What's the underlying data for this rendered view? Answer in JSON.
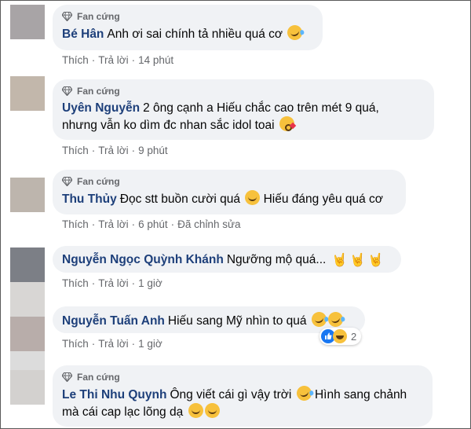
{
  "badge_label": "Fan cứng",
  "like_label": "Thích",
  "reply_label": "Trả lời",
  "comments": [
    {
      "name": "Bé Hân",
      "badge": true,
      "text": "Anh ơi sai chính tả nhiều quá cơ",
      "text_line2": "",
      "time": "14 phút",
      "edited": ""
    },
    {
      "name": "Uyên Nguyễn",
      "badge": true,
      "text": "2 ông cạnh a Hiếu chắc cao trên mét 9 quá,",
      "text_line2": "nhưng vẫn ko dìm đc nhan sắc idol toai",
      "time": "9 phút",
      "edited": ""
    },
    {
      "name": "Thu Thủy",
      "badge": true,
      "text": "Đọc stt buồn cười quá",
      "text_after": "Hiếu đáng yêu quá cơ",
      "time": "6 phút",
      "edited": "Đã chỉnh sửa"
    },
    {
      "name": "Nguyễn Ngọc Quỳnh Khánh",
      "badge": false,
      "text": "Ngưỡng mộ quá...",
      "time": "1 giờ",
      "edited": ""
    },
    {
      "name": "Nguyễn Tuấn Anh",
      "badge": false,
      "text": "Hiếu sang Mỹ nhìn to quá",
      "time": "1 giờ",
      "edited": "",
      "reaction_count": "2"
    },
    {
      "name": "Le Thi Nhu Quynh",
      "badge": true,
      "text": "Ông viết cái gì vậy trời",
      "text_after": "Hình sang chảnh",
      "text_line2": "mà cái cap lạc lõng dạ",
      "time": "",
      "edited": ""
    }
  ],
  "icons": {
    "badge": "diamond-icon",
    "laugh": "rolling-laugh-emoji",
    "kiss": "kiss-emoji",
    "grin": "grin-emoji",
    "horns": "rock-hand-emoji",
    "like": "like-reaction-icon",
    "haha": "haha-reaction-icon"
  },
  "colors": {
    "bubble": "#f0f2f5",
    "name": "#1d3f7a",
    "meta": "#65676b",
    "like_blue": "#1877f2",
    "emoji_yellow": "#f7c13c"
  }
}
